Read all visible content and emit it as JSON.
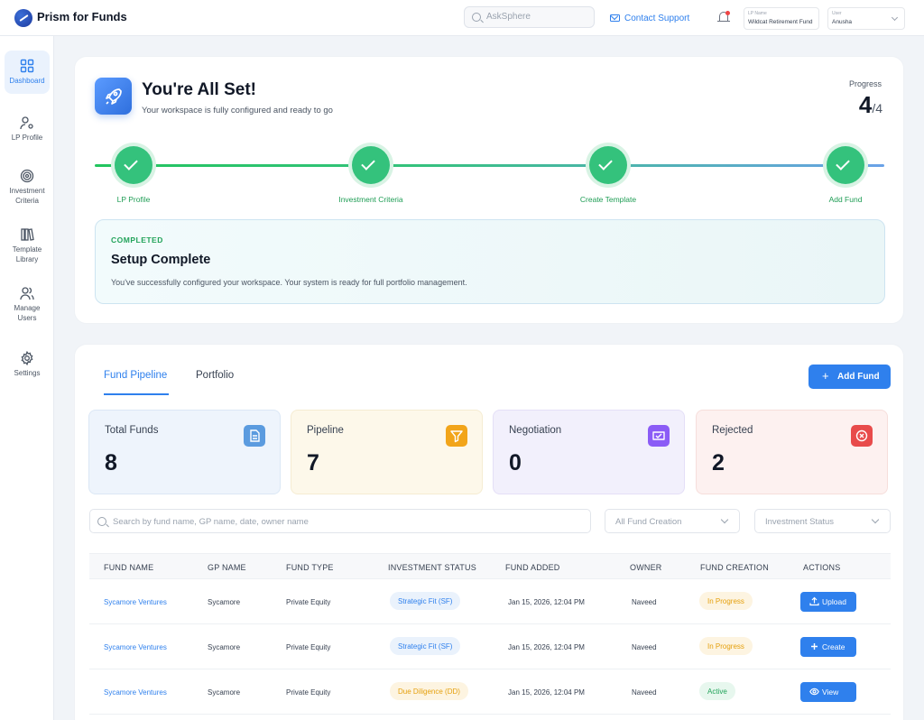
{
  "app": {
    "title": "Prism for Funds"
  },
  "header": {
    "search_placeholder": "AskSphere",
    "support_label": "Contact Support",
    "lp_label": "LP Name",
    "lp_value": "Wildcat Retirement Fund",
    "user_label": "User",
    "user_value": "Anusha"
  },
  "sidebar": {
    "items": [
      {
        "label": "Dashboard",
        "icon": "grid-icon"
      },
      {
        "label": "LP Profile",
        "icon": "user-settings-icon"
      },
      {
        "label": "Investment Criteria",
        "icon": "target-icon"
      },
      {
        "label": "Template Library",
        "icon": "books-icon"
      },
      {
        "label": "Manage Users",
        "icon": "users-icon"
      },
      {
        "label": "Settings",
        "icon": "gear-icon"
      }
    ]
  },
  "setup": {
    "title": "You're All Set!",
    "subtitle": "Your workspace is fully configured and ready to go",
    "progress_label": "Progress",
    "progress_current": "4",
    "progress_total": "/4",
    "steps": [
      {
        "label": "LP Profile",
        "status": "done"
      },
      {
        "label": "Investment Criteria",
        "status": "done"
      },
      {
        "label": "Create Template",
        "status": "done"
      },
      {
        "label": "Add Fund",
        "status": "done"
      }
    ],
    "completed_tag": "COMPLETED",
    "completed_title": "Setup Complete",
    "completed_desc": "You've successfully configured your workspace. Your system is ready for full portfolio management."
  },
  "pipeline": {
    "tabs": [
      {
        "label": "Fund Pipeline",
        "active": true
      },
      {
        "label": "Portfolio",
        "active": false
      }
    ],
    "add_button": "Add Fund",
    "stats": [
      {
        "label": "Total Funds",
        "value": "8",
        "icon": "document-icon",
        "color": "#5b9bdf"
      },
      {
        "label": "Pipeline",
        "value": "7",
        "icon": "filter-icon",
        "color": "#f2a51a"
      },
      {
        "label": "Negotiation",
        "value": "0",
        "icon": "handshake-icon",
        "color": "#8b5cf6"
      },
      {
        "label": "Rejected",
        "value": "2",
        "icon": "x-circle-icon",
        "color": "#e84b4b"
      }
    ],
    "search_placeholder": "Search by fund name, GP name, date, owner name",
    "filter_creation": "All Fund Creation",
    "filter_status": "Investment Status",
    "columns": [
      "FUND NAME",
      "GP NAME",
      "FUND TYPE",
      "INVESTMENT STATUS",
      "FUND ADDED",
      "OWNER",
      "FUND CREATION",
      "ACTIONS"
    ],
    "rows": [
      {
        "fund": "Sycamore Ventures",
        "gp": "Sycamore",
        "type": "Private Equity",
        "status": "Strategic Fit (SF)",
        "status_style": "blue",
        "added": "Jan 15, 2026, 12:04 PM",
        "owner": "Naveed",
        "creation": "In Progress",
        "creation_style": "orange",
        "action": "Upload",
        "action_icon": "upload-icon"
      },
      {
        "fund": "Sycamore Ventures",
        "gp": "Sycamore",
        "type": "Private Equity",
        "status": "Strategic Fit (SF)",
        "status_style": "blue",
        "added": "Jan 15, 2026, 12:04 PM",
        "owner": "Naveed",
        "creation": "In Progress",
        "creation_style": "orange",
        "action": "Create",
        "action_icon": "plus-icon"
      },
      {
        "fund": "Sycamore Ventures",
        "gp": "Sycamore",
        "type": "Private Equity",
        "status": "Due Diligence (DD)",
        "status_style": "orange",
        "added": "Jan 15, 2026, 12:04 PM",
        "owner": "Naveed",
        "creation": "Active",
        "creation_style": "green",
        "action": "View",
        "action_icon": "eye-icon"
      }
    ]
  }
}
